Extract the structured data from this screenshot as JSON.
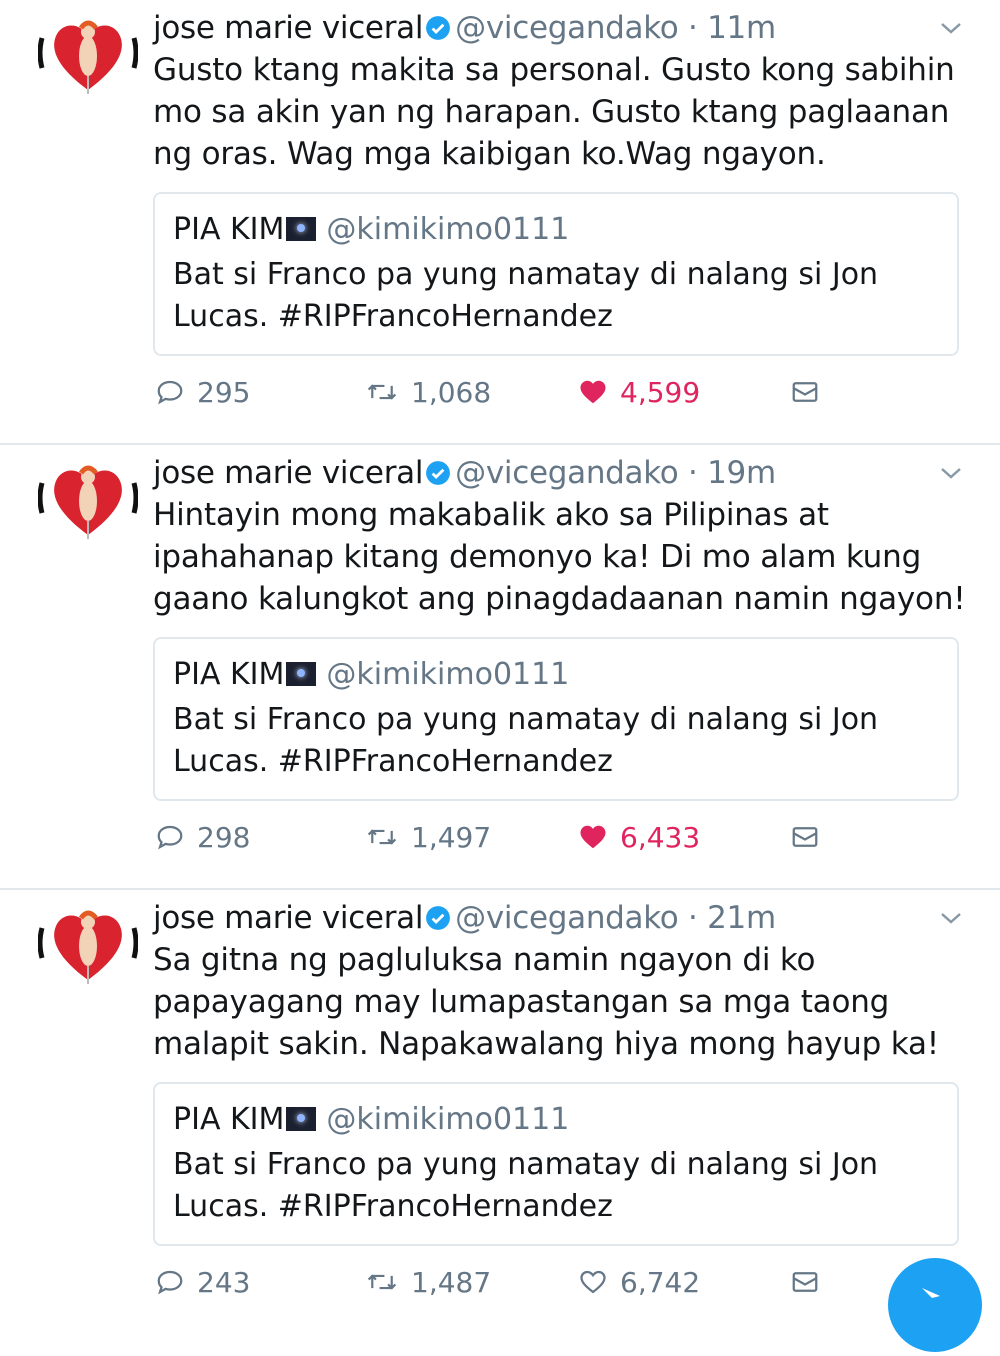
{
  "colors": {
    "accent": "#1da1f2",
    "like": "#e0245e",
    "muted": "#657786",
    "text": "#14171a",
    "border": "#e1e8ed"
  },
  "tweets": [
    {
      "name": "jose marie viceral",
      "handle": "@vicegandako",
      "time": "· 11m",
      "text": "Gusto ktang makita sa personal. Gusto kong sabihin mo sa akin yan ng harapan. Gusto ktang paglaanan ng oras. Wag mga kaibigan ko.Wag ngayon.",
      "quote": {
        "name": "PIA KIM",
        "handle": "@kimikimo0111",
        "text": "Bat si Franco pa yung namatay di nalang si Jon Lucas. #RIPFrancoHernandez"
      },
      "replies": "295",
      "retweets": "1,068",
      "likes": "4,599",
      "liked": true
    },
    {
      "name": "jose marie viceral",
      "handle": "@vicegandako",
      "time": "· 19m",
      "text": "Hintayin mong makabalik ako sa Pilipinas at ipahahanap kitang demonyo ka! Di mo alam kung gaano kalungkot ang pinagdadaanan namin ngayon!",
      "quote": {
        "name": "PIA KIM",
        "handle": "@kimikimo0111",
        "text": "Bat si Franco pa yung namatay di nalang si Jon Lucas. #RIPFrancoHernandez"
      },
      "replies": "298",
      "retweets": "1,497",
      "likes": "6,433",
      "liked": true
    },
    {
      "name": "jose marie viceral",
      "handle": "@vicegandako",
      "time": "· 21m",
      "text": "Sa gitna ng pagluluksa namin ngayon di ko papayagang may lumapastangan sa mga taong malapit sakin. Napakawalang hiya mong hayup ka!",
      "quote": {
        "name": "PIA KIM",
        "handle": "@kimikimo0111",
        "text": "Bat si Franco pa yung namatay di nalang si Jon Lucas. #RIPFrancoHernandez"
      },
      "replies": "243",
      "retweets": "1,487",
      "likes": "6,742",
      "liked": false
    }
  ]
}
